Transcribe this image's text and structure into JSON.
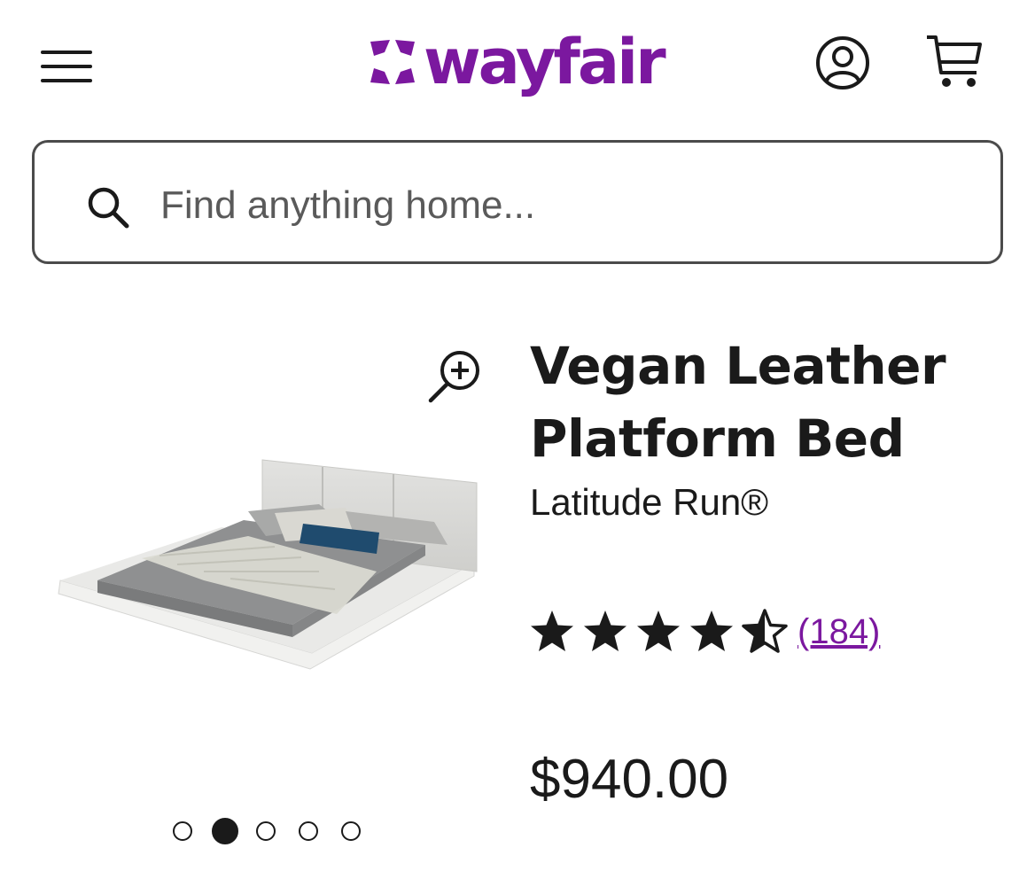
{
  "header": {
    "logo_text": "wayfair",
    "brand_color": "#7b189f",
    "menu_icon": "hamburger-menu-icon",
    "account_icon": "user-circle-icon",
    "cart_icon": "shopping-cart-icon"
  },
  "search": {
    "placeholder": "Find anything home...",
    "value": "",
    "icon": "search-icon"
  },
  "product": {
    "title": "Vegan Leather Platform Bed",
    "brand": "Latitude Run®",
    "rating": 4.5,
    "rating_max": 5,
    "reviews_label": "(184)",
    "price": "$940.00",
    "image_icon": "platform-bed-image",
    "zoom_icon": "zoom-in-icon",
    "carousel": {
      "total": 5,
      "active_index": 1
    }
  }
}
